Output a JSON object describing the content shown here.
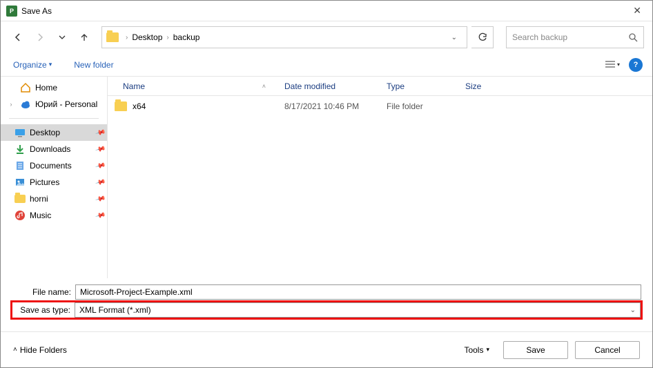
{
  "window": {
    "title": "Save As"
  },
  "breadcrumb": {
    "segments": [
      "Desktop",
      "backup"
    ]
  },
  "search": {
    "placeholder": "Search backup"
  },
  "toolbar": {
    "organize": "Organize",
    "new_folder": "New folder"
  },
  "sidebar": {
    "top": [
      {
        "label": "Home",
        "icon": "home"
      },
      {
        "label": "Юрий - Personal",
        "icon": "cloud",
        "expandable": true
      }
    ],
    "items": [
      {
        "label": "Desktop",
        "icon": "monitor",
        "pinned": true,
        "selected": true
      },
      {
        "label": "Downloads",
        "icon": "download",
        "pinned": true
      },
      {
        "label": "Documents",
        "icon": "doc",
        "pinned": true
      },
      {
        "label": "Pictures",
        "icon": "pic",
        "pinned": true
      },
      {
        "label": "horni",
        "icon": "folder",
        "pinned": true
      },
      {
        "label": "Music",
        "icon": "music",
        "pinned": true
      }
    ]
  },
  "columns": {
    "name": "Name",
    "date": "Date modified",
    "type": "Type",
    "size": "Size"
  },
  "rows": [
    {
      "name": "x64",
      "date": "8/17/2021 10:46 PM",
      "type": "File folder"
    }
  ],
  "fields": {
    "filename_label": "File name:",
    "filename_value": "Microsoft-Project-Example.xml",
    "type_label": "Save as type:",
    "type_value": "XML Format (*.xml)"
  },
  "footer": {
    "hide_folders": "Hide Folders",
    "tools": "Tools",
    "save": "Save",
    "cancel": "Cancel"
  }
}
